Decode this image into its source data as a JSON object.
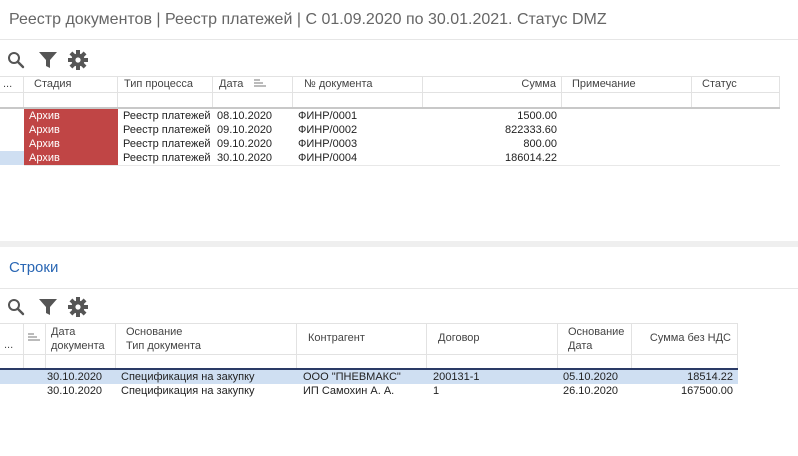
{
  "title": "Реестр документов | Реестр платежей | С 01.09.2020 по 30.01.2021. Статус DMZ",
  "toolbar": {
    "icons": [
      "search-icon",
      "filter-icon",
      "gear-icon"
    ]
  },
  "top_table": {
    "columns": [
      "...",
      "Стадия",
      "Тип процесса",
      "Дата",
      "№ документа",
      "Сумма",
      "Примечание",
      "Статус"
    ],
    "rows": [
      {
        "stage": "Архив",
        "type": "Реестр платежей",
        "date": "08.10.2020",
        "doc": "ФИНР/0001",
        "sum": "1500.00",
        "note": "",
        "status": ""
      },
      {
        "stage": "Архив",
        "type": "Реестр платежей",
        "date": "09.10.2020",
        "doc": "ФИНР/0002",
        "sum": "822333.60",
        "note": "",
        "status": ""
      },
      {
        "stage": "Архив",
        "type": "Реестр платежей",
        "date": "09.10.2020",
        "doc": "ФИНР/0003",
        "sum": "800.00",
        "note": "",
        "status": ""
      },
      {
        "stage": "Архив",
        "type": "Реестр платежей",
        "date": "30.10.2020",
        "doc": "ФИНР/0004",
        "sum": "186014.22",
        "note": "",
        "status": ""
      }
    ],
    "stage_color": "#c04545",
    "selected_color": "#cfdff2"
  },
  "lines_section": {
    "title": "Строки",
    "columns": {
      "more": "...",
      "date": [
        "Дата",
        "документа"
      ],
      "basis": [
        "Основание",
        "Тип документа"
      ],
      "counterparty": "Контрагент",
      "contract": "Договор",
      "basis_date": [
        "Основание",
        "Дата"
      ],
      "sum_no_vat": "Сумма без НДС"
    },
    "rows": [
      {
        "date": "30.10.2020",
        "basis": "Спецификация на закупку",
        "counterparty": "ООО \"ПНЕВМАКС\"",
        "contract": "200131-1",
        "basis_date": "05.10.2020",
        "sum": "18514.22"
      },
      {
        "date": "30.10.2020",
        "basis": "Спецификация на закупку",
        "counterparty": "ИП Самохин А. А.",
        "contract": "1",
        "basis_date": "26.10.2020",
        "sum": "167500.00"
      }
    ]
  }
}
